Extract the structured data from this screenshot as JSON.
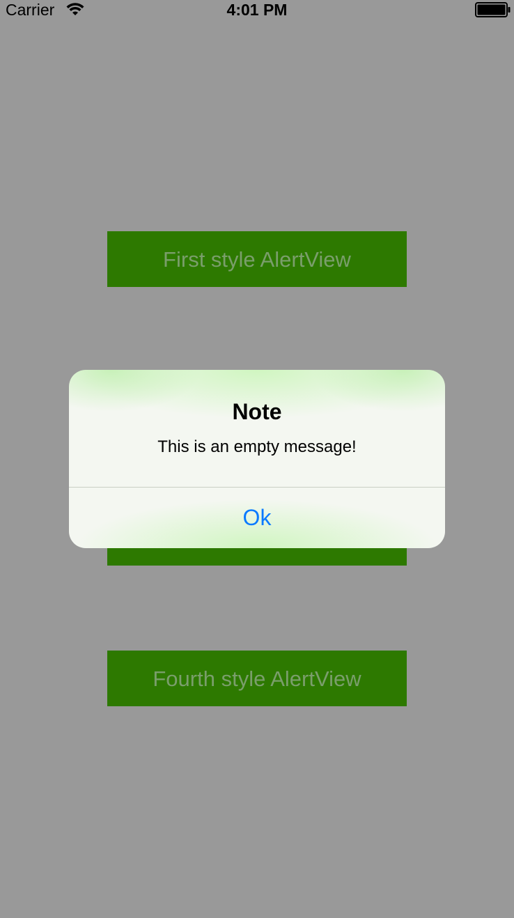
{
  "status_bar": {
    "carrier": "Carrier",
    "time": "4:01 PM",
    "wifi_icon": "wifi-icon",
    "battery_icon": "battery-full-icon"
  },
  "buttons": {
    "first": "First style AlertView",
    "fourth": "Fourth style AlertView"
  },
  "alert": {
    "title": "Note",
    "message": "This is an empty message!",
    "ok_label": "Ok"
  },
  "colors": {
    "background_dim": "#999999",
    "button_green": "#2d7900",
    "link_blue": "#0a7aff"
  }
}
